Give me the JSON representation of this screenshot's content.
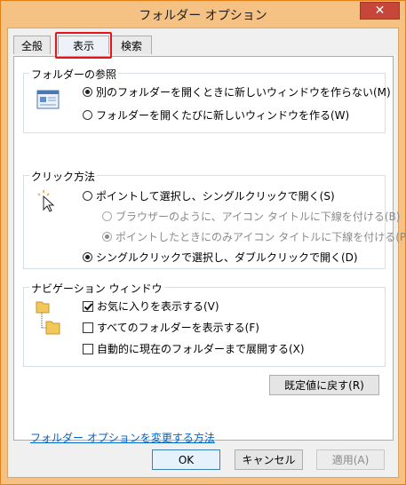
{
  "window": {
    "title": "フォルダー オプション",
    "close_symbol": "✕"
  },
  "tabs": [
    {
      "label": "全般",
      "active": true
    },
    {
      "label": "表示",
      "active": false,
      "highlighted": true
    },
    {
      "label": "検索",
      "active": false
    }
  ],
  "browse_folders": {
    "legend": "フォルダーの参照",
    "icon": "folder-window-icon",
    "options": [
      {
        "label": "別のフォルダーを開くときに新しいウィンドウを作らない(M)",
        "selected": true
      },
      {
        "label": "フォルダーを開くたびに新しいウィンドウを作る(W)",
        "selected": false
      }
    ]
  },
  "click_items": {
    "legend": "クリック方法",
    "icon": "pointer-click-icon",
    "single_click": {
      "label": "ポイントして選択し、シングルクリックで開く(S)",
      "selected": false
    },
    "sub_options": [
      {
        "label": "ブラウザーのように、アイコン タイトルに下線を付ける(B)",
        "selected": false,
        "disabled": true
      },
      {
        "label": "ポイントしたときにのみアイコン タイトルに下線を付ける(P)",
        "selected": true,
        "disabled": true
      }
    ],
    "double_click": {
      "label": "シングルクリックで選択し、ダブルクリックで開く(D)",
      "selected": true
    }
  },
  "navigation_pane": {
    "legend": "ナビゲーション ウィンドウ",
    "icon": "folder-tree-icon",
    "checkboxes": [
      {
        "label": "お気に入りを表示する(V)",
        "checked": true
      },
      {
        "label": "すべてのフォルダーを表示する(F)",
        "checked": false
      },
      {
        "label": "自動的に現在のフォルダーまで展開する(X)",
        "checked": false
      }
    ]
  },
  "restore_defaults_label": "既定値に戻す(R)",
  "help_link": "フォルダー オプションを変更する方法",
  "buttons": {
    "ok": "OK",
    "cancel": "キャンセル",
    "apply": "適用(A)"
  },
  "colors": {
    "frame": "#f6c284",
    "close_button": "#c7463a",
    "highlight_box": "#e8141b",
    "link": "#0066cc"
  }
}
